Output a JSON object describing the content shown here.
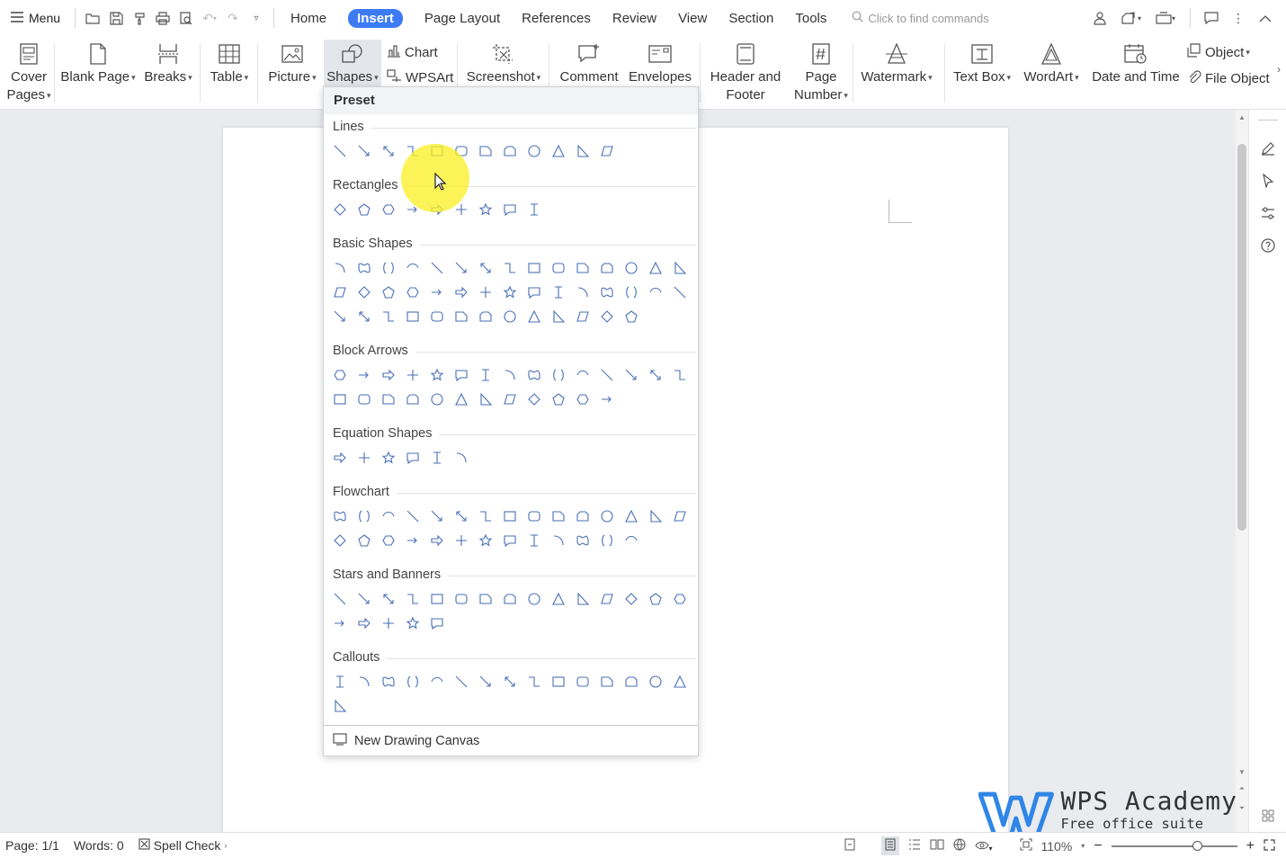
{
  "topbar": {
    "menu_label": "Menu",
    "tabs": [
      "Home",
      "Insert",
      "Page Layout",
      "References",
      "Review",
      "View",
      "Section",
      "Tools"
    ],
    "active_tab": "Insert",
    "search_placeholder": "Click to find commands"
  },
  "ribbon": {
    "cover_pages_1": "Cover",
    "cover_pages_2": "Pages",
    "blank_page": "Blank Page",
    "breaks": "Breaks",
    "table": "Table",
    "picture": "Picture",
    "shapes": "Shapes",
    "chart": "Chart",
    "wpsart": "WPSArt",
    "screenshot": "Screenshot",
    "comment": "Comment",
    "envelopes": "Envelopes",
    "header_footer_1": "Header and",
    "header_footer_2": "Footer",
    "page_number_1": "Page",
    "page_number_2": "Number",
    "watermark": "Watermark",
    "text_box": "Text Box",
    "wordart": "WordArt",
    "date_time": "Date and Time",
    "object": "Object",
    "file_object": "File Object"
  },
  "dropdown": {
    "header": "Preset",
    "sections": {
      "lines": "Lines",
      "rectangles": "Rectangles",
      "basic": "Basic Shapes",
      "block_arrows": "Block Arrows",
      "equation": "Equation Shapes",
      "flowchart": "Flowchart",
      "stars": "Stars and Banners",
      "callouts": "Callouts"
    },
    "new_canvas": "New Drawing Canvas"
  },
  "status": {
    "page": "Page: 1/1",
    "words": "Words: 0",
    "spell_check": "Spell Check",
    "zoom": "110%",
    "zoom_level_percent": 110
  },
  "watermark": {
    "brand": "WPS Academy",
    "tagline": "Free office suite tutorials"
  },
  "colors": {
    "accent": "#3c7bf4",
    "shape_stroke": "#4a6fb5",
    "highlight": "#faf028"
  }
}
